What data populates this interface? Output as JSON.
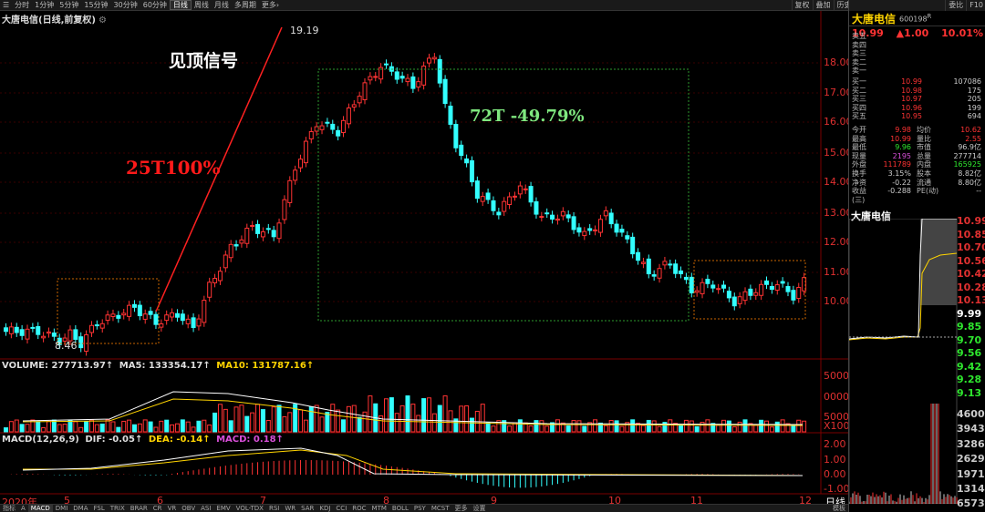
{
  "toolbar": {
    "left": [
      "☰",
      "分时",
      "1分钟",
      "5分钟",
      "15分钟",
      "30分钟",
      "60分钟",
      "日线",
      "周线",
      "月线",
      "多周期",
      "更多›"
    ],
    "active": "日线",
    "right": [
      "复权",
      "叠加",
      "历史",
      "统计",
      "画线",
      "F10",
      "标记",
      "+自选",
      "返回"
    ]
  },
  "chart_title": "大唐电信(日线,前复权)",
  "annotations": {
    "signal": "见顶信号",
    "rise": "25T100%",
    "fall": "72T -49.79%",
    "high": "19.19",
    "low": "8.46"
  },
  "price_axis": [
    "18.00",
    "17.00",
    "16.00",
    "15.00",
    "14.00",
    "13.00",
    "12.00",
    "11.00",
    "10.00"
  ],
  "volume": {
    "label_vol": "VOLUME: 277713.97↑",
    "label_ma5": "MA5: 133354.17↑",
    "label_ma10": "MA10: 131787.16↑",
    "axis": [
      "5000",
      "0000",
      "5000",
      "X100"
    ]
  },
  "macd": {
    "label_name": "MACD(12,26,9)",
    "label_dif": "DIF: -0.05↑",
    "label_dea": "DEA: -0.14↑",
    "label_macd": "MACD: 0.18↑",
    "axis": [
      "2.00",
      "1.00",
      "0.00",
      "-1.00"
    ]
  },
  "dates": [
    "2020年",
    "5",
    "6",
    "7",
    "8",
    "9",
    "10",
    "11",
    "12",
    "日线"
  ],
  "bottombar": [
    "指标",
    "A",
    "MACD",
    "DMI",
    "DMA",
    "FSL",
    "TRIX",
    "BRAR",
    "CR",
    "VR",
    "OBV",
    "ASI",
    "EMV",
    "VOL-TDX",
    "RSI",
    "WR",
    "SAR",
    "KDJ",
    "CCI",
    "ROC",
    "MTM",
    "BOLL",
    "PSY",
    "MCST",
    "更多",
    "设置"
  ],
  "bottom_active": "MACD",
  "bottom_right": "模板",
  "panel": {
    "name": "大唐电信",
    "code": "600198",
    "code_sup": "R",
    "price": "10.99",
    "change": "▲1.00",
    "pct": "10.01%",
    "tabs": [
      "委比",
      "F10"
    ],
    "sell": [
      {
        "label": "卖五",
        "price": "",
        "vol": ""
      },
      {
        "label": "卖四",
        "price": "",
        "vol": ""
      },
      {
        "label": "卖三",
        "price": "",
        "vol": ""
      },
      {
        "label": "卖二",
        "price": "",
        "vol": ""
      },
      {
        "label": "卖一",
        "price": "",
        "vol": ""
      }
    ],
    "buy": [
      {
        "label": "买一",
        "price": "10.99",
        "vol": "107086"
      },
      {
        "label": "买二",
        "price": "10.98",
        "vol": "175"
      },
      {
        "label": "买三",
        "price": "10.97",
        "vol": "205"
      },
      {
        "label": "买四",
        "price": "10.96",
        "vol": "199"
      },
      {
        "label": "买五",
        "price": "10.95",
        "vol": "694"
      }
    ],
    "stats": [
      {
        "l1": "今开",
        "v1": "9.98",
        "c1": "#ff3333",
        "l2": "均价",
        "v2": "10.62",
        "c2": "#ff3333"
      },
      {
        "l1": "最高",
        "v1": "10.99",
        "c1": "#ff3333",
        "l2": "量比",
        "v2": "2.55",
        "c2": "#ff3333"
      },
      {
        "l1": "最低",
        "v1": "9.96",
        "c1": "#2ee62e",
        "l2": "市值",
        "v2": "96.9亿",
        "c2": "#ccc"
      },
      {
        "l1": "现量",
        "v1": "2195",
        "c1": "#d94fd9",
        "l2": "总量",
        "v2": "277714",
        "c2": "#ccc"
      },
      {
        "l1": "外盘",
        "v1": "111789",
        "c1": "#ff3333",
        "l2": "内盘",
        "v2": "165925",
        "c2": "#2ee62e"
      },
      {
        "l1": "换手",
        "v1": "3.15%",
        "c1": "#ccc",
        "l2": "股本",
        "v2": "8.82亿",
        "c2": "#ccc"
      },
      {
        "l1": "净资",
        "v1": "-0.22",
        "c1": "#ccc",
        "l2": "流通",
        "v2": "8.80亿",
        "c2": "#ccc"
      },
      {
        "l1": "收益(三)",
        "v1": "-0.288",
        "c1": "#ccc",
        "l2": "PE(动)",
        "v2": "--",
        "c2": "#ccc"
      }
    ],
    "mini_title": "大唐电信",
    "mini_axis": [
      "10.99",
      "10.85",
      "10.70",
      "10.56",
      "10.42",
      "10.28",
      "10.13",
      "9.99",
      "9.85",
      "9.70",
      "9.56",
      "9.42",
      "9.28",
      "9.13"
    ],
    "mini_vol_axis": [
      "46008",
      "39435",
      "32862",
      "26290",
      "19717",
      "13145",
      "6573"
    ]
  },
  "colors": {
    "up": "#ff3333",
    "down": "#33ffff",
    "bg": "#000000",
    "box": "#c0c0c0"
  }
}
